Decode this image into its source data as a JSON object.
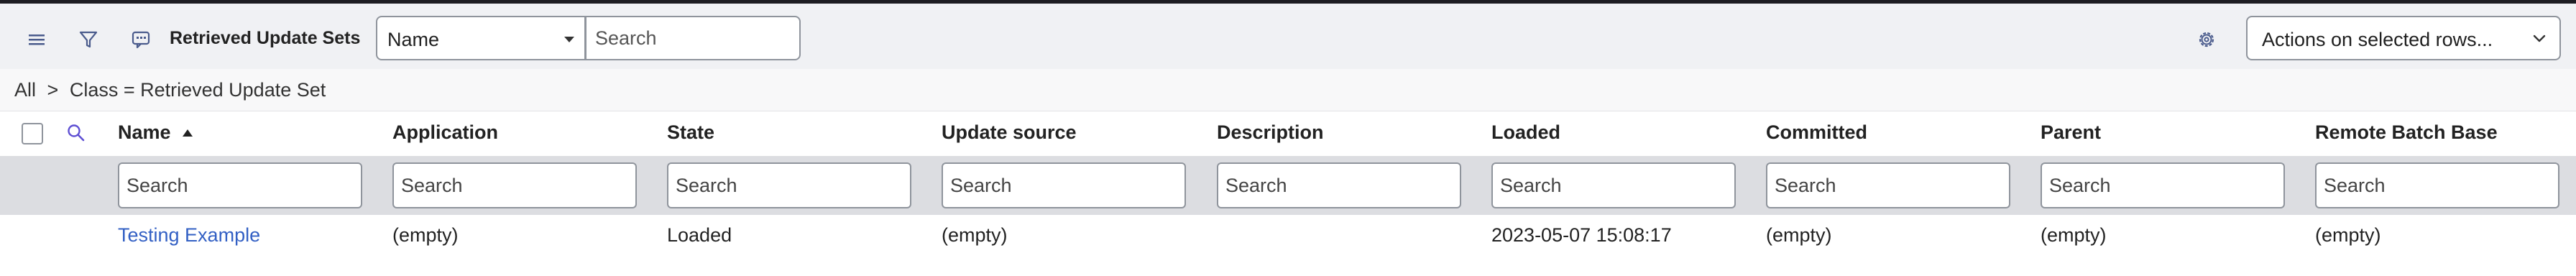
{
  "toolbar": {
    "title": "Retrieved Update Sets",
    "field_select_value": "Name",
    "search_placeholder": "Search",
    "actions_label": "Actions on selected rows...",
    "icons": [
      "hamburger-menu-icon",
      "filter-icon",
      "chat-icon",
      "gear-icon",
      "chevron-down-icon"
    ]
  },
  "breadcrumb": {
    "root": "All",
    "separator": ">",
    "condition": "Class = Retrieved Update Set"
  },
  "table": {
    "columns": [
      "Name",
      "Application",
      "State",
      "Update source",
      "Description",
      "Loaded",
      "Committed",
      "Parent",
      "Remote Batch Base"
    ],
    "sort_column": "Name",
    "sort_direction": "ascending",
    "column_search_placeholder": "Search",
    "rows": [
      {
        "name": "Testing Example",
        "application": "(empty)",
        "state": "Loaded",
        "update_source": "(empty)",
        "description": "",
        "loaded": "2023-05-07 15:08:17",
        "committed": "(empty)",
        "parent": "(empty)",
        "remote_batch_base": "(empty)"
      }
    ]
  },
  "colors": {
    "toolbar_bg": "#f0f1f4",
    "filter_row_bg": "#dcdde1",
    "link": "#3360c4",
    "icon_accent": "#5e4fd3"
  }
}
